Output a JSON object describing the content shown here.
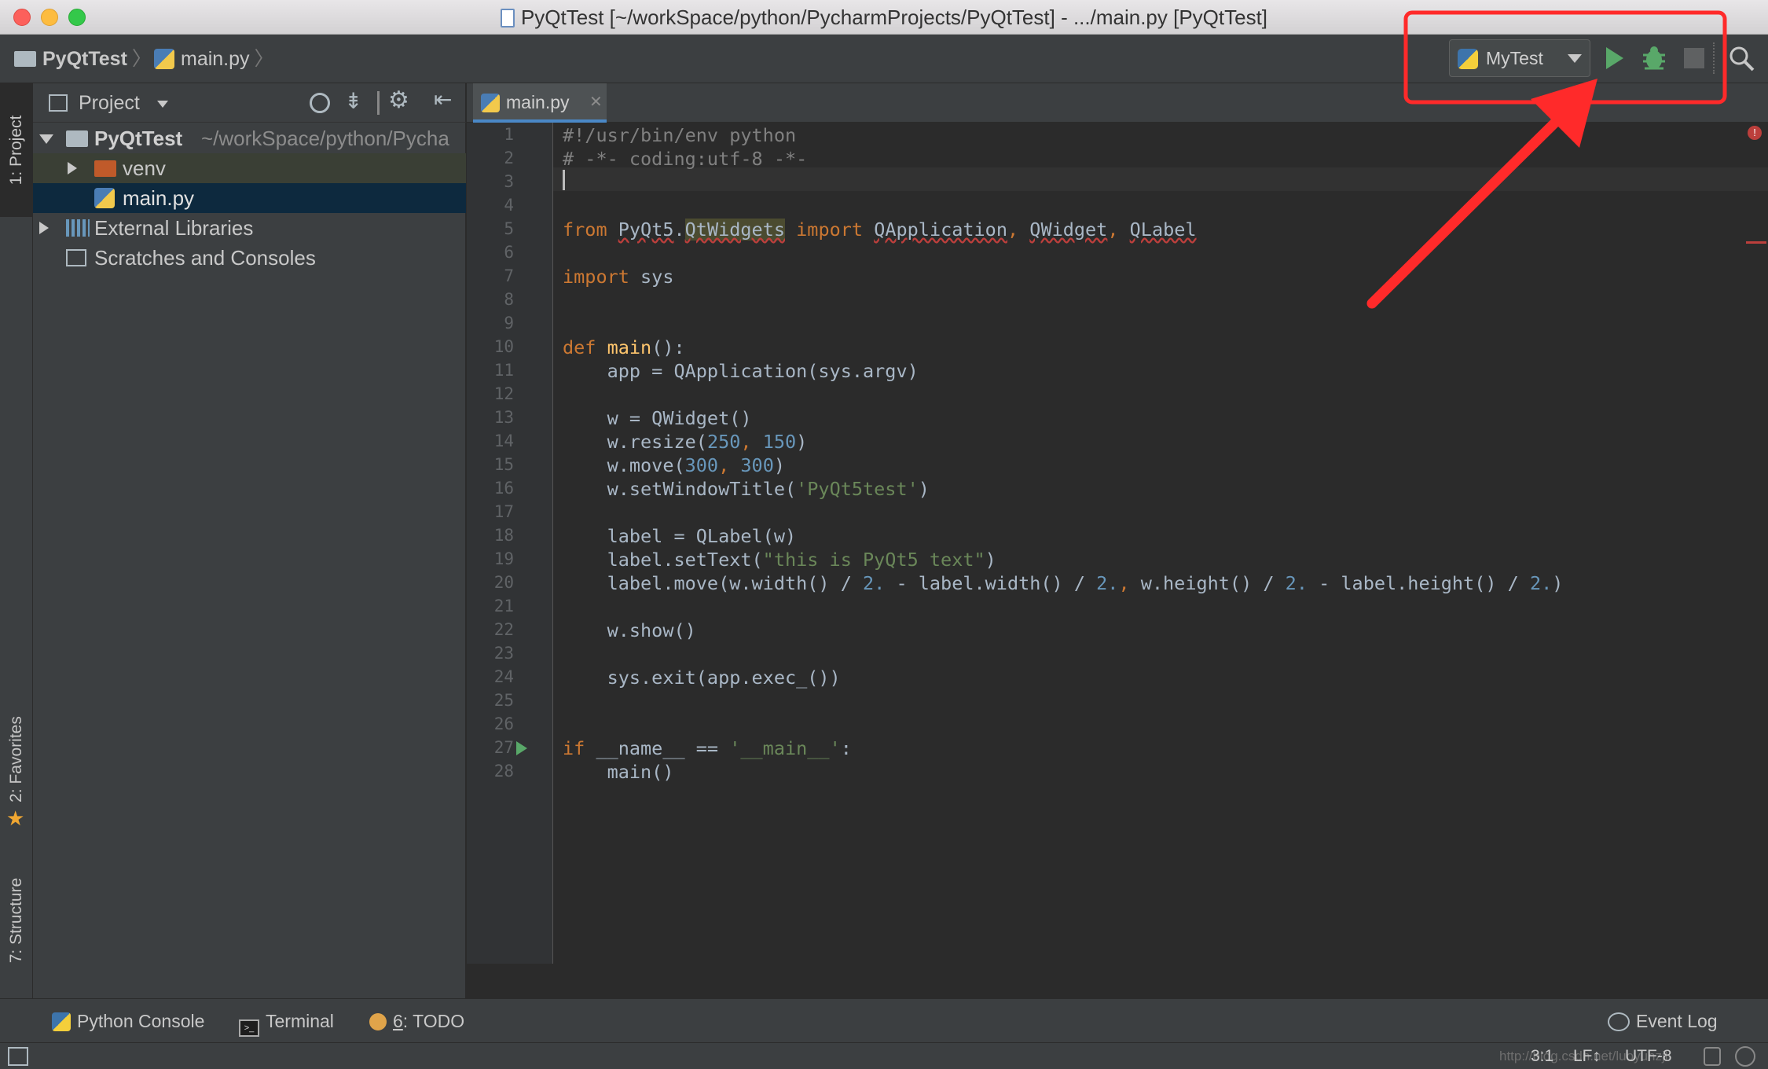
{
  "window": {
    "title": "PyQtTest [~/workSpace/python/PycharmProjects/PyQtTest] - .../main.py [PyQtTest]"
  },
  "breadcrumb": {
    "project": "PyQtTest",
    "file": "main.py"
  },
  "run_config": {
    "name": "MyTest"
  },
  "side_tabs": {
    "project": "1: Project",
    "favorites": "2: Favorites",
    "structure": "7: Structure"
  },
  "project_panel": {
    "title": "Project",
    "root_name": "PyQtTest",
    "root_path": "~/workSpace/python/Pycha",
    "items": [
      {
        "label": "venv"
      },
      {
        "label": "main.py"
      },
      {
        "label": "External Libraries"
      },
      {
        "label": "Scratches and Consoles"
      }
    ]
  },
  "editor": {
    "tab": "main.py",
    "line_numbers": [
      "1",
      "2",
      "3",
      "4",
      "5",
      "6",
      "7",
      "8",
      "9",
      "10",
      "11",
      "12",
      "13",
      "14",
      "15",
      "16",
      "17",
      "18",
      "19",
      "20",
      "21",
      "22",
      "23",
      "24",
      "25",
      "26",
      "27",
      "28"
    ]
  },
  "bottom_tools": {
    "python_console": "Python Console",
    "terminal": "Terminal",
    "todo_num": "6",
    "todo_label": ": TODO",
    "event_log": "Event Log"
  },
  "status": {
    "position": "3:1",
    "line_sep": "LF↕",
    "encoding": "UTF-8",
    "watermark": "http://blog.csdn.net/luoyunzjl"
  },
  "colors": {
    "annotation": "#ff2a2a",
    "run_green": "#59a869",
    "keyword": "#cc7832",
    "string": "#6a8759",
    "number": "#6897bb",
    "function_name": "#ffc66d"
  }
}
